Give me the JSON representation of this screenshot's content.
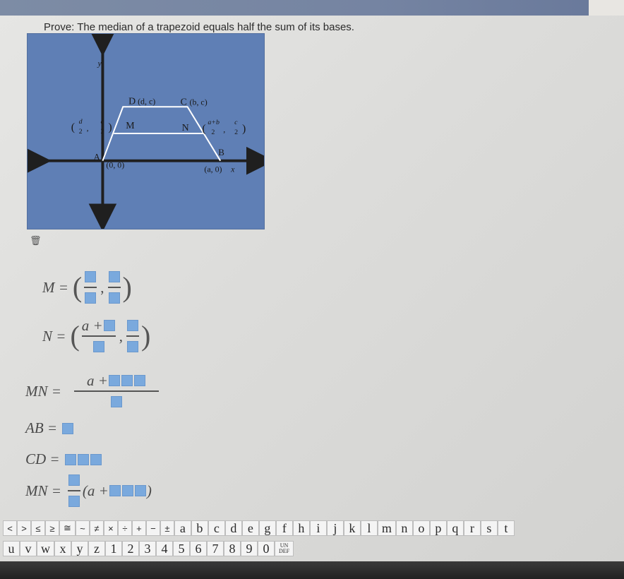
{
  "prompt": "Prove: The median of a trapezoid equals half the sum of its bases.",
  "graph": {
    "y_axis": "y",
    "x_axis": "x",
    "point_D": "D",
    "coord_D": "(d, c)",
    "point_C": "C",
    "coord_C": "(b, c)",
    "point_M": "M",
    "coord_M_num1": "d",
    "coord_M_num2": "c",
    "coord_M_den": "2",
    "point_N": "N",
    "coord_N_num1": "a+b",
    "coord_N_num2": "c",
    "coord_N_den": "2",
    "point_A": "A",
    "coord_A": "(0, 0)",
    "point_B": "B",
    "coord_B": "(a, 0)",
    "colors": {
      "background": "#5f7fb5",
      "axis": "#1f1f1f",
      "shape": "#ffffff"
    }
  },
  "equations": {
    "m_label": "M =",
    "n_label": "N =",
    "n_num_prefix": "a +",
    "mn_label": "MN =",
    "mn_num_prefix": "a +",
    "ab_label": "AB =",
    "cd_label": "CD =",
    "mn2_label": "MN =",
    "mn2_prefix": "(a +",
    "mn2_suffix": ")"
  },
  "keyboard": {
    "row1": [
      "<",
      ">",
      "≤",
      "≥",
      "≅",
      "~",
      "≠",
      "×",
      "÷",
      "+",
      "−",
      "±",
      "a",
      "b",
      "c",
      "d",
      "e",
      "g",
      "f",
      "h",
      "i",
      "j",
      "k",
      "l",
      "m",
      "n",
      "o",
      "p",
      "q",
      "r",
      "s",
      "t"
    ],
    "row2": [
      "u",
      "v",
      "w",
      "x",
      "y",
      "z",
      "1",
      "2",
      "3",
      "4",
      "5",
      "6",
      "7",
      "8",
      "9",
      "0"
    ],
    "undo_top": "UN",
    "undo_bottom": "DEF"
  },
  "input_box_color": "#7aa9dd"
}
